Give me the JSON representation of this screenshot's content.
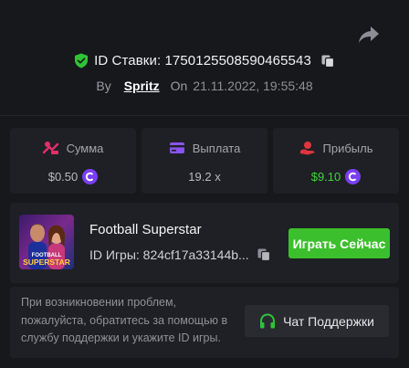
{
  "header": {
    "bet_id_label": "ID Ставки: 1750125508590465543",
    "by_label": "By",
    "username": "Spritz",
    "on_label": "On",
    "datetime": "21.11.2022, 19:55:48"
  },
  "stats": [
    {
      "label": "Сумма",
      "value": "$0.50",
      "icon": "bet-amount-icon",
      "coin": true
    },
    {
      "label": "Выплата",
      "value": "19.2 x",
      "icon": "payout-icon",
      "coin": false
    },
    {
      "label": "Прибыль",
      "value": "$9.10",
      "icon": "profit-icon",
      "coin": true
    }
  ],
  "game": {
    "name": "Football Superstar",
    "id_label": "ID Игры: 824cf17a33144b...",
    "thumbnail_text_line1": "FOOTBALL",
    "thumbnail_text_line2": "SUPERSTAR",
    "play_label": "Играть Сейчас"
  },
  "support": {
    "message": "При возникновении проблем, пожалуйста, обратитесь за помощью в службу поддержки и укажите ID игры.",
    "button_label": "Чат Поддержки"
  },
  "colors": {
    "background": "#17181c",
    "card": "#1f2025",
    "accent_green": "#3cbf2c",
    "profit_green": "#41d33c",
    "coin_purple": "#7a3ff2",
    "icon_pink": "#e0306a",
    "icon_purple": "#8a52f0",
    "icon_red": "#e0353d"
  }
}
